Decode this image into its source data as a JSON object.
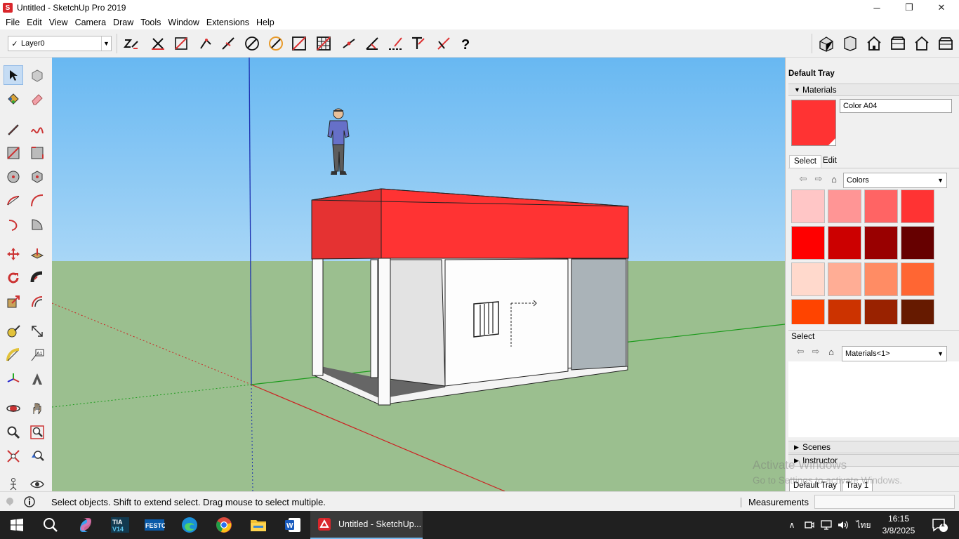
{
  "window": {
    "title": "Untitled - SketchUp Pro 2019",
    "minimize": "─",
    "maximize": "❐",
    "close": "✕"
  },
  "menu": [
    "File",
    "Edit",
    "View",
    "Camera",
    "Draw",
    "Tools",
    "Window",
    "Extensions",
    "Help"
  ],
  "layer": {
    "check": "✓",
    "value": "Layer0"
  },
  "tray": {
    "title": "Default Tray",
    "materials": {
      "header": "Materials",
      "current_name": "Color A04",
      "current_color": "#ff3333",
      "tabs": [
        "Select",
        "Edit"
      ],
      "library": "Colors",
      "swatches": [
        "#ffc6c6",
        "#ff9595",
        "#ff6464",
        "#ff3333",
        "#ff0000",
        "#cc0000",
        "#990000",
        "#660000",
        "#ffd9cc",
        "#ffad95",
        "#ff8c64",
        "#ff6633",
        "#ff4400",
        "#cc3300",
        "#992200",
        "#661a00"
      ]
    },
    "select": {
      "header": "Select",
      "library": "Materials<1>"
    },
    "scenes": "Scenes",
    "instructor": "Instructor",
    "bottom_tabs": [
      "Default Tray",
      "Tray 1"
    ]
  },
  "status": {
    "text": "Select objects. Shift to extend select. Drag mouse to select multiple.",
    "measurements_label": "Measurements"
  },
  "taskbar": {
    "active_app": "Untitled - SketchUp...",
    "time": "16:15",
    "date": "3/8/2025",
    "lang": "ไทย",
    "notifications": "1"
  },
  "watermark": {
    "line1": "Activate Windows",
    "line2": "Go to Settings to activate Windows."
  }
}
